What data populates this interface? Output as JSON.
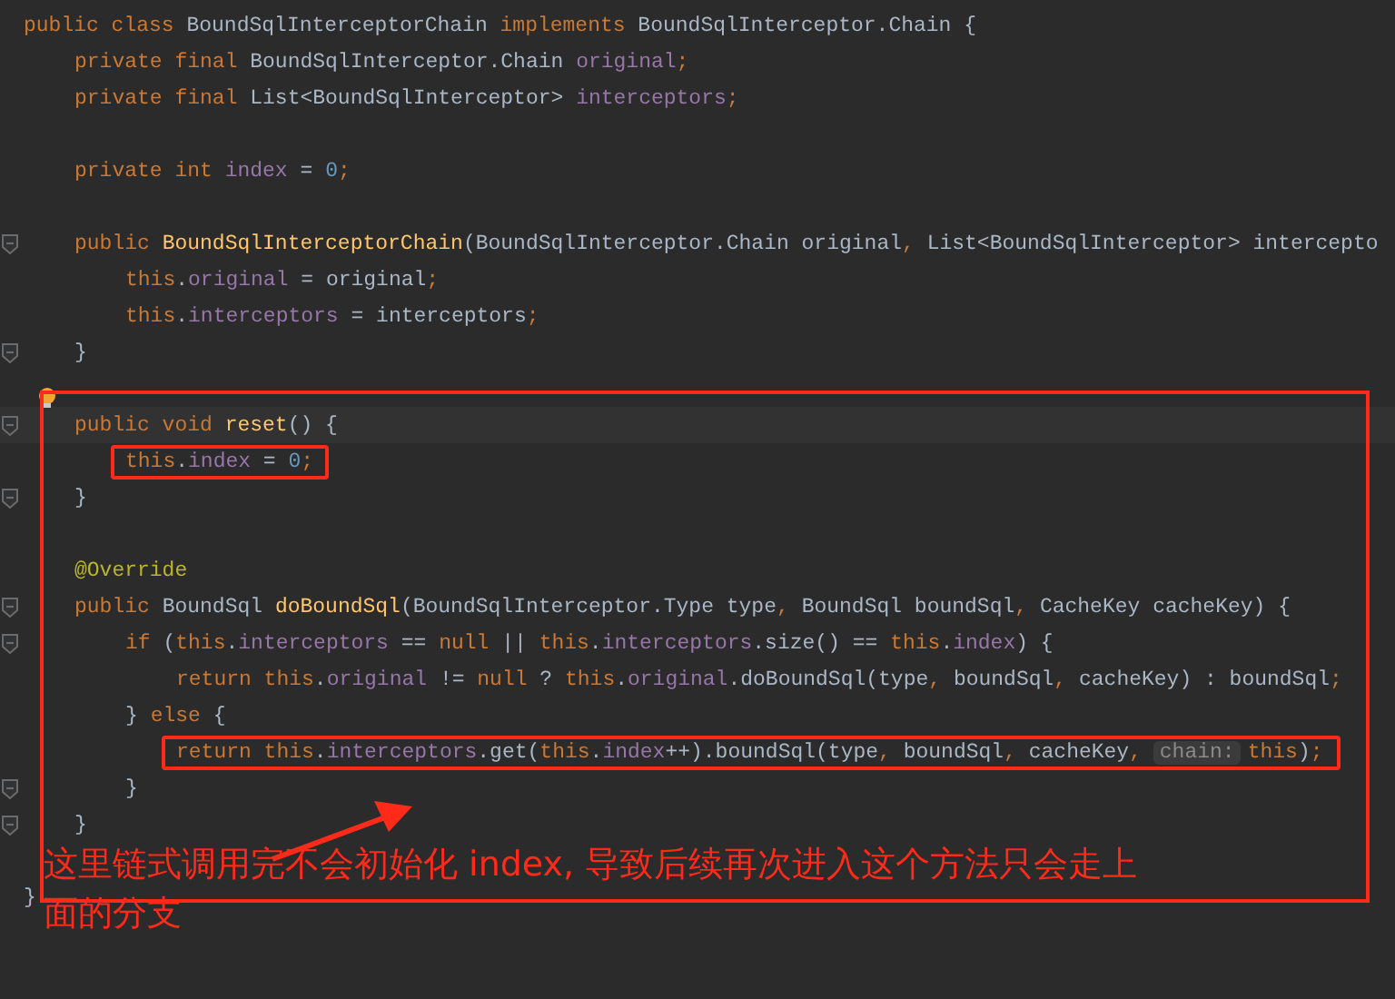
{
  "lines": [
    {
      "kind": "code",
      "fold": false,
      "current": false,
      "boxed": false,
      "tokens": [
        {
          "kind": "keyword",
          "text": "public class"
        },
        {
          "kind": "plain",
          "text": " BoundSqlInterceptorChain "
        },
        {
          "kind": "keyword",
          "text": "implements"
        },
        {
          "kind": "plain",
          "text": " BoundSqlInterceptor.Chain {"
        }
      ],
      "children": [
        {
          "kind": "code",
          "fold": false,
          "current": false,
          "boxed": false,
          "tokens": [
            {
              "kind": "keyword",
              "text": "private final"
            },
            {
              "kind": "plain",
              "text": " BoundSqlInterceptor.Chain "
            },
            {
              "kind": "field",
              "text": "original"
            },
            {
              "kind": "keyword",
              "text": ";"
            }
          ]
        },
        {
          "kind": "code",
          "fold": false,
          "current": false,
          "boxed": false,
          "tokens": [
            {
              "kind": "keyword",
              "text": "private final"
            },
            {
              "kind": "plain",
              "text": " List<BoundSqlInterceptor> "
            },
            {
              "kind": "field",
              "text": "interceptors"
            },
            {
              "kind": "keyword",
              "text": ";"
            }
          ]
        },
        {
          "kind": "blank"
        },
        {
          "kind": "code",
          "fold": false,
          "current": false,
          "boxed": false,
          "tokens": [
            {
              "kind": "keyword",
              "text": "private int "
            },
            {
              "kind": "field",
              "text": "index"
            },
            {
              "kind": "plain",
              "text": " = "
            },
            {
              "kind": "number",
              "text": "0"
            },
            {
              "kind": "keyword",
              "text": ";"
            }
          ]
        },
        {
          "kind": "blank"
        },
        {
          "kind": "code",
          "fold": true,
          "current": false,
          "boxed": false,
          "tokens": [
            {
              "kind": "keyword",
              "text": "public "
            },
            {
              "kind": "method",
              "text": "BoundSqlInterceptorChain"
            },
            {
              "kind": "plain",
              "text": "(BoundSqlInterceptor.Chain original"
            },
            {
              "kind": "keyword",
              "text": ", "
            },
            {
              "kind": "plain",
              "text": "List<BoundSqlInterceptor> intercepto"
            }
          ],
          "children": [
            {
              "kind": "code",
              "fold": false,
              "current": false,
              "boxed": false,
              "tokens": [
                {
                  "kind": "keyword",
                  "text": "this"
                },
                {
                  "kind": "plain",
                  "text": "."
                },
                {
                  "kind": "field",
                  "text": "original"
                },
                {
                  "kind": "plain",
                  "text": " = original"
                },
                {
                  "kind": "keyword",
                  "text": ";"
                }
              ]
            },
            {
              "kind": "code",
              "fold": false,
              "current": false,
              "boxed": false,
              "tokens": [
                {
                  "kind": "keyword",
                  "text": "this"
                },
                {
                  "kind": "plain",
                  "text": "."
                },
                {
                  "kind": "field",
                  "text": "interceptors"
                },
                {
                  "kind": "plain",
                  "text": " = interceptors"
                },
                {
                  "kind": "keyword",
                  "text": ";"
                }
              ]
            }
          ]
        },
        {
          "kind": "code",
          "fold": true,
          "current": false,
          "boxed": false,
          "tokens": [
            {
              "kind": "plain",
              "text": "}"
            }
          ]
        },
        {
          "kind": "blank"
        },
        {
          "kind": "code",
          "fold": true,
          "current": true,
          "boxed": false,
          "tokens": [
            {
              "kind": "keyword",
              "text": "public void "
            },
            {
              "kind": "method",
              "text": "reset"
            },
            {
              "kind": "plain",
              "text": "() {"
            }
          ],
          "children": [
            {
              "kind": "code",
              "fold": false,
              "current": false,
              "boxed": true,
              "tokens": [
                {
                  "kind": "keyword",
                  "text": "this"
                },
                {
                  "kind": "plain",
                  "text": "."
                },
                {
                  "kind": "field",
                  "text": "index"
                },
                {
                  "kind": "plain",
                  "text": " = "
                },
                {
                  "kind": "number",
                  "text": "0"
                },
                {
                  "kind": "keyword",
                  "text": ";"
                }
              ]
            }
          ]
        },
        {
          "kind": "code",
          "fold": true,
          "current": false,
          "boxed": false,
          "tokens": [
            {
              "kind": "plain",
              "text": "}"
            }
          ]
        },
        {
          "kind": "blank"
        },
        {
          "kind": "code",
          "fold": false,
          "current": false,
          "boxed": false,
          "tokens": [
            {
              "kind": "annotation",
              "text": "@Override"
            }
          ]
        },
        {
          "kind": "code",
          "fold": true,
          "current": false,
          "boxed": false,
          "tokens": [
            {
              "kind": "keyword",
              "text": "public "
            },
            {
              "kind": "plain",
              "text": "BoundSql "
            },
            {
              "kind": "method",
              "text": "doBoundSql"
            },
            {
              "kind": "plain",
              "text": "(BoundSqlInterceptor.Type type"
            },
            {
              "kind": "keyword",
              "text": ", "
            },
            {
              "kind": "plain",
              "text": "BoundSql boundSql"
            },
            {
              "kind": "keyword",
              "text": ", "
            },
            {
              "kind": "plain",
              "text": "CacheKey cacheKey) {"
            }
          ],
          "children": [
            {
              "kind": "code",
              "fold": true,
              "current": false,
              "boxed": false,
              "tokens": [
                {
                  "kind": "keyword",
                  "text": "if "
                },
                {
                  "kind": "plain",
                  "text": "("
                },
                {
                  "kind": "keyword",
                  "text": "this"
                },
                {
                  "kind": "plain",
                  "text": "."
                },
                {
                  "kind": "field",
                  "text": "interceptors"
                },
                {
                  "kind": "plain",
                  "text": " == "
                },
                {
                  "kind": "keyword",
                  "text": "null "
                },
                {
                  "kind": "plain",
                  "text": "|| "
                },
                {
                  "kind": "keyword",
                  "text": "this"
                },
                {
                  "kind": "plain",
                  "text": "."
                },
                {
                  "kind": "field",
                  "text": "interceptors"
                },
                {
                  "kind": "plain",
                  "text": ".size() == "
                },
                {
                  "kind": "keyword",
                  "text": "this"
                },
                {
                  "kind": "plain",
                  "text": "."
                },
                {
                  "kind": "field",
                  "text": "index"
                },
                {
                  "kind": "plain",
                  "text": ") {"
                }
              ],
              "children": [
                {
                  "kind": "code",
                  "fold": false,
                  "current": false,
                  "boxed": false,
                  "tokens": [
                    {
                      "kind": "keyword",
                      "text": "return this"
                    },
                    {
                      "kind": "plain",
                      "text": "."
                    },
                    {
                      "kind": "field",
                      "text": "original"
                    },
                    {
                      "kind": "plain",
                      "text": " != "
                    },
                    {
                      "kind": "keyword",
                      "text": "null "
                    },
                    {
                      "kind": "plain",
                      "text": "? "
                    },
                    {
                      "kind": "keyword",
                      "text": "this"
                    },
                    {
                      "kind": "plain",
                      "text": "."
                    },
                    {
                      "kind": "field",
                      "text": "original"
                    },
                    {
                      "kind": "plain",
                      "text": ".doBoundSql(type"
                    },
                    {
                      "kind": "keyword",
                      "text": ", "
                    },
                    {
                      "kind": "plain",
                      "text": "boundSql"
                    },
                    {
                      "kind": "keyword",
                      "text": ", "
                    },
                    {
                      "kind": "plain",
                      "text": "cacheKey) : boundSql"
                    },
                    {
                      "kind": "keyword",
                      "text": ";"
                    }
                  ]
                }
              ]
            },
            {
              "kind": "code",
              "fold": false,
              "current": false,
              "boxed": false,
              "tokens": [
                {
                  "kind": "plain",
                  "text": "} "
                },
                {
                  "kind": "keyword",
                  "text": "else "
                },
                {
                  "kind": "plain",
                  "text": "{"
                }
              ],
              "children": [
                {
                  "kind": "code",
                  "fold": false,
                  "current": false,
                  "boxed": true,
                  "tokens": [
                    {
                      "kind": "keyword",
                      "text": "return this"
                    },
                    {
                      "kind": "plain",
                      "text": "."
                    },
                    {
                      "kind": "field",
                      "text": "interceptors"
                    },
                    {
                      "kind": "plain",
                      "text": ".get("
                    },
                    {
                      "kind": "keyword",
                      "text": "this"
                    },
                    {
                      "kind": "plain",
                      "text": "."
                    },
                    {
                      "kind": "field",
                      "text": "index"
                    },
                    {
                      "kind": "plain",
                      "text": "++).boundSql(type"
                    },
                    {
                      "kind": "keyword",
                      "text": ", "
                    },
                    {
                      "kind": "plain",
                      "text": "boundSql"
                    },
                    {
                      "kind": "keyword",
                      "text": ", "
                    },
                    {
                      "kind": "plain",
                      "text": "cacheKey"
                    },
                    {
                      "kind": "keyword",
                      "text": ", "
                    },
                    {
                      "kind": "hint",
                      "text": "chain:"
                    },
                    {
                      "kind": "keyword",
                      "text": "this"
                    },
                    {
                      "kind": "plain",
                      "text": ")"
                    },
                    {
                      "kind": "keyword",
                      "text": ";"
                    }
                  ]
                }
              ]
            },
            {
              "kind": "code",
              "fold": true,
              "current": false,
              "boxed": false,
              "tokens": [
                {
                  "kind": "plain",
                  "text": "}"
                }
              ]
            }
          ]
        },
        {
          "kind": "code",
          "fold": true,
          "current": false,
          "boxed": false,
          "tokens": [
            {
              "kind": "plain",
              "text": "}"
            }
          ]
        },
        {
          "kind": "blank"
        }
      ]
    },
    {
      "kind": "code",
      "fold": false,
      "current": false,
      "boxed": false,
      "tokens": [
        {
          "kind": "plain",
          "text": "}"
        }
      ]
    }
  ],
  "annotation": {
    "text": "这里链式调用完不会初始化 index, 导致后续再次进入这个方法只会走上面的分支"
  }
}
